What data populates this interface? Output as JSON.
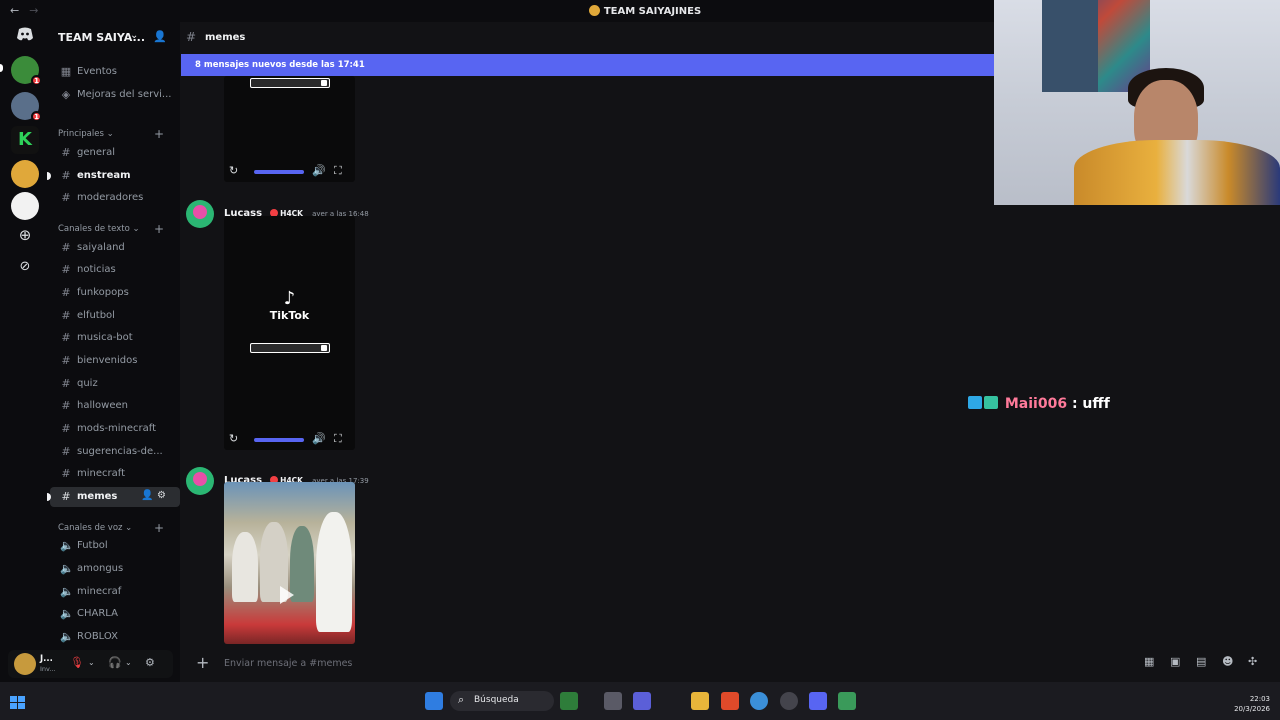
{
  "window": {
    "title": "TEAM SAIYAJINES"
  },
  "server": {
    "name": "TEAM SAIYA...",
    "top_items": [
      {
        "label": "Eventos",
        "icon": "calendar-icon"
      },
      {
        "label": "Mejoras del servi...",
        "icon": "boost-icon"
      }
    ],
    "categories": [
      {
        "label": "Principales",
        "channels": [
          {
            "label": "general",
            "icon": "hash-icon"
          },
          {
            "label": "enstream",
            "icon": "hash-icon",
            "unread": true
          },
          {
            "label": "moderadores",
            "icon": "hash-icon"
          }
        ]
      },
      {
        "label": "Canales de texto",
        "channels": [
          {
            "label": "saiyaland",
            "icon": "hash-icon"
          },
          {
            "label": "noticias",
            "icon": "hash-icon"
          },
          {
            "label": "funkopops",
            "icon": "hash-icon"
          },
          {
            "label": "elfutbol",
            "icon": "hash-icon"
          },
          {
            "label": "musica-bot",
            "icon": "hash-icon"
          },
          {
            "label": "bienvenidos",
            "icon": "hash-icon"
          },
          {
            "label": "quiz",
            "icon": "hash-icon"
          },
          {
            "label": "halloween",
            "icon": "hash-icon"
          },
          {
            "label": "mods-minecraft",
            "icon": "hash-icon"
          },
          {
            "label": "sugerencias-de...",
            "icon": "hash-icon"
          },
          {
            "label": "minecraft",
            "icon": "hash-icon"
          },
          {
            "label": "memes",
            "icon": "hash-icon",
            "active": true
          }
        ]
      },
      {
        "label": "Canales de voz",
        "channels": [
          {
            "label": "Futbol",
            "icon": "speaker-icon"
          },
          {
            "label": "amongus",
            "icon": "speaker-icon"
          },
          {
            "label": "minecraf",
            "icon": "speaker-icon"
          },
          {
            "label": "CHARLA",
            "icon": "speaker-icon"
          },
          {
            "label": "ROBLOX",
            "icon": "speaker-icon"
          }
        ]
      }
    ]
  },
  "user": {
    "name": "J...",
    "status": "Inv..."
  },
  "channel": {
    "name": "memes",
    "new_messages_bar": "8 mensajes nuevos desde las 17:41"
  },
  "messages": [
    {
      "author": "Lucass",
      "tag": "H4CK",
      "time": "ayer a las 16:48",
      "attachment": "tiktok-video",
      "tiktok_word": "TikTok"
    },
    {
      "author": "Lucass",
      "tag": "H4CK",
      "time": "ayer a las 17:39",
      "attachment": "video-photo"
    }
  ],
  "stream_chat": {
    "user": "Maii006",
    "text": ": ufff"
  },
  "composer": {
    "placeholder": "Enviar mensaje a #memes"
  },
  "taskbar": {
    "search_label": "Búsqueda",
    "clock_time": "22:03",
    "clock_date": "20/3/2026"
  },
  "colors": {
    "accent": "#5865f2",
    "background": "#121215",
    "sidebar": "#0c0c0f"
  }
}
